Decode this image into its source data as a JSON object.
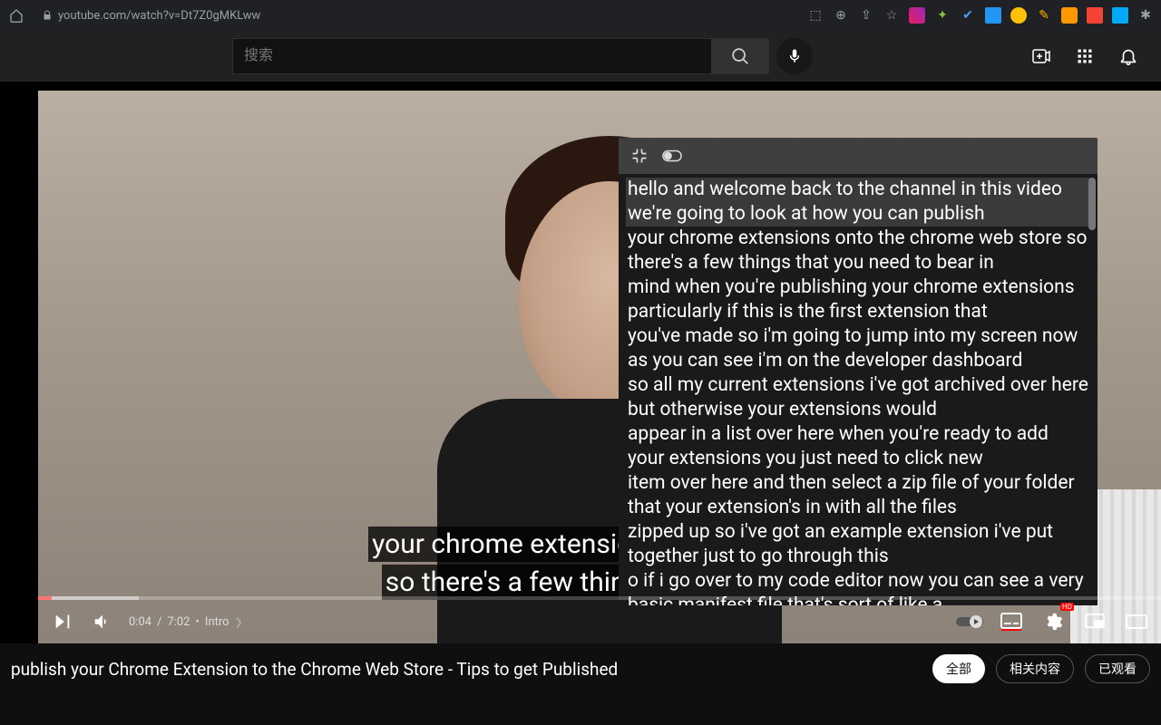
{
  "browser": {
    "url": "youtube.com/watch?v=Dt7Z0gMKLww"
  },
  "search": {
    "placeholder": "搜索"
  },
  "captions": {
    "line1": "your chrome extensions o",
    "line2": "so there's a few things t"
  },
  "transcript": [
    "hello and welcome back to the channel in this  video we're going to look at how you can publish",
    "your chrome extensions onto the chrome web store  so there's a few things that you need to bear in",
    "mind when you're publishing your chrome extensions  particularly if this is the first extension that",
    "you've made so i'm going to jump into my screen  now as you can see i'm on the developer dashboard",
    "so all my current extensions i've got archived  over here but otherwise your extensions would",
    "appear in a list over here when you're ready to  add your extensions you just need to click new",
    "item over here and then select a zip file of your  folder that your extension's in with all the files",
    "zipped up so i've got an example extension  i've put together just to go through this",
    "o if i go over to my code editor now you can see  a very basic manifest file that's sort of like a"
  ],
  "transcript_active_index": 0,
  "player": {
    "current": "0:04",
    "duration": "7:02",
    "chapter": "Intro"
  },
  "video_title": "publish your Chrome Extension to the Chrome Web Store - Tips to get Published",
  "chips": {
    "all": "全部",
    "related": "相关内容",
    "watched": "已观看"
  }
}
